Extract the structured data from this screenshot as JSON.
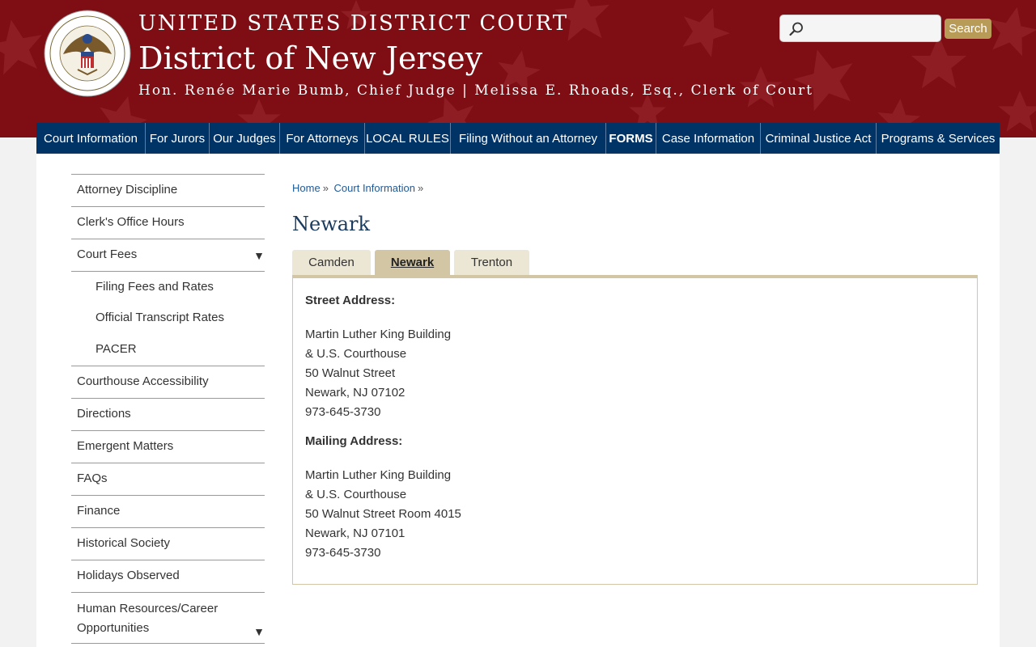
{
  "header": {
    "court_line1": "UNITED STATES DISTRICT COURT",
    "court_line2": "District of New Jersey",
    "court_line3": "Hon. Renée Marie Bumb, Chief Judge | Melissa E. Rhoads, Esq., Clerk of Court",
    "search_placeholder": "",
    "search_button": "Search",
    "seal_icon": "court-seal-icon"
  },
  "nav": [
    {
      "label": "Court Information",
      "bold": false
    },
    {
      "label": "For Jurors",
      "bold": false
    },
    {
      "label": "Our Judges",
      "bold": false
    },
    {
      "label": "For Attorneys",
      "bold": false
    },
    {
      "label": "LOCAL RULES",
      "bold": false
    },
    {
      "label": "Filing Without an Attorney",
      "bold": false
    },
    {
      "label": "FORMS",
      "bold": true
    },
    {
      "label": "Case Information",
      "bold": false
    },
    {
      "label": "Criminal Justice Act",
      "bold": false
    },
    {
      "label": "Programs & Services",
      "bold": false
    }
  ],
  "sidebar": [
    {
      "label": "Attorney Discipline"
    },
    {
      "label": "Clerk's Office Hours"
    },
    {
      "label": "Court Fees",
      "caret": "▼"
    },
    {
      "label": "Filing Fees and Rates",
      "sub": true
    },
    {
      "label": "Official Transcript Rates",
      "sub": true
    },
    {
      "label": "PACER",
      "sub": true
    },
    {
      "label": "Courthouse Accessibility"
    },
    {
      "label": "Directions"
    },
    {
      "label": "Emergent Matters"
    },
    {
      "label": "FAQs"
    },
    {
      "label": "Finance"
    },
    {
      "label": "Historical Society"
    },
    {
      "label": "Holidays Observed"
    },
    {
      "label": "Human Resources/Career Opportunities",
      "caret": "▼",
      "tall": true
    }
  ],
  "breadcrumb": {
    "home": "Home",
    "section": "Court Information",
    "separator": "»"
  },
  "page": {
    "title": "Newark"
  },
  "tabs": [
    {
      "label": "Camden",
      "active": false
    },
    {
      "label": "Newark",
      "active": true
    },
    {
      "label": "Trenton",
      "active": false
    }
  ],
  "panel": {
    "street_label": "Street Address:",
    "street_lines": [
      "Martin Luther King Building",
      "& U.S. Courthouse",
      "50 Walnut Street",
      "Newark, NJ 07102",
      "973-645-3730"
    ],
    "mailing_label": "Mailing Address:",
    "mailing_lines": [
      "Martin Luther King Building",
      "& U.S. Courthouse",
      "50 Walnut Street Room 4015",
      "Newark, NJ 07101",
      "973-645-3730"
    ]
  },
  "colors": {
    "header_red": "#7e0d14",
    "nav_blue": "#003366",
    "tab_tan": "#d3c6a4",
    "search_gold": "#b99b58"
  }
}
